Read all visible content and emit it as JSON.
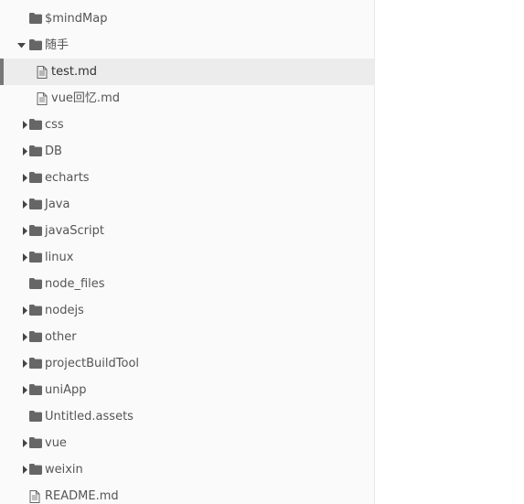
{
  "sidebar": {
    "items": [
      {
        "label": "$mindMap",
        "type": "folder",
        "depth": 0,
        "expandable": false,
        "expanded": false,
        "active": false
      },
      {
        "label": "随手",
        "type": "folder",
        "depth": 0,
        "expandable": true,
        "expanded": true,
        "active": false
      },
      {
        "label": "test.md",
        "type": "file",
        "depth": 1,
        "expandable": false,
        "expanded": false,
        "active": true
      },
      {
        "label": "vue回忆.md",
        "type": "file",
        "depth": 1,
        "expandable": false,
        "expanded": false,
        "active": false
      },
      {
        "label": "css",
        "type": "folder",
        "depth": 0,
        "expandable": true,
        "expanded": false,
        "active": false
      },
      {
        "label": "DB",
        "type": "folder",
        "depth": 0,
        "expandable": true,
        "expanded": false,
        "active": false
      },
      {
        "label": "echarts",
        "type": "folder",
        "depth": 0,
        "expandable": true,
        "expanded": false,
        "active": false
      },
      {
        "label": "Java",
        "type": "folder",
        "depth": 0,
        "expandable": true,
        "expanded": false,
        "active": false
      },
      {
        "label": "javaScript",
        "type": "folder",
        "depth": 0,
        "expandable": true,
        "expanded": false,
        "active": false
      },
      {
        "label": "linux",
        "type": "folder",
        "depth": 0,
        "expandable": true,
        "expanded": false,
        "active": false
      },
      {
        "label": "node_files",
        "type": "folder",
        "depth": 0,
        "expandable": false,
        "expanded": false,
        "active": false
      },
      {
        "label": "nodejs",
        "type": "folder",
        "depth": 0,
        "expandable": true,
        "expanded": false,
        "active": false
      },
      {
        "label": "other",
        "type": "folder",
        "depth": 0,
        "expandable": true,
        "expanded": false,
        "active": false
      },
      {
        "label": "projectBuildTool",
        "type": "folder",
        "depth": 0,
        "expandable": true,
        "expanded": false,
        "active": false
      },
      {
        "label": "uniApp",
        "type": "folder",
        "depth": 0,
        "expandable": true,
        "expanded": false,
        "active": false
      },
      {
        "label": "Untitled.assets",
        "type": "folder",
        "depth": 0,
        "expandable": false,
        "expanded": false,
        "active": false
      },
      {
        "label": "vue",
        "type": "folder",
        "depth": 0,
        "expandable": true,
        "expanded": false,
        "active": false
      },
      {
        "label": "weixin",
        "type": "folder",
        "depth": 0,
        "expandable": true,
        "expanded": false,
        "active": false
      },
      {
        "label": "README.md",
        "type": "file",
        "depth": 0,
        "expandable": false,
        "expanded": false,
        "active": false
      }
    ]
  },
  "icons": {
    "folder": "folder-icon",
    "file": "file-icon",
    "caret_collapsed": "caret-right-icon",
    "caret_expanded": "caret-down-icon"
  },
  "colors": {
    "sidebar_bg": "#fafafa",
    "active_row_bg": "#ececec",
    "active_marker": "#777777",
    "text": "#555555",
    "icon": "#666666"
  }
}
